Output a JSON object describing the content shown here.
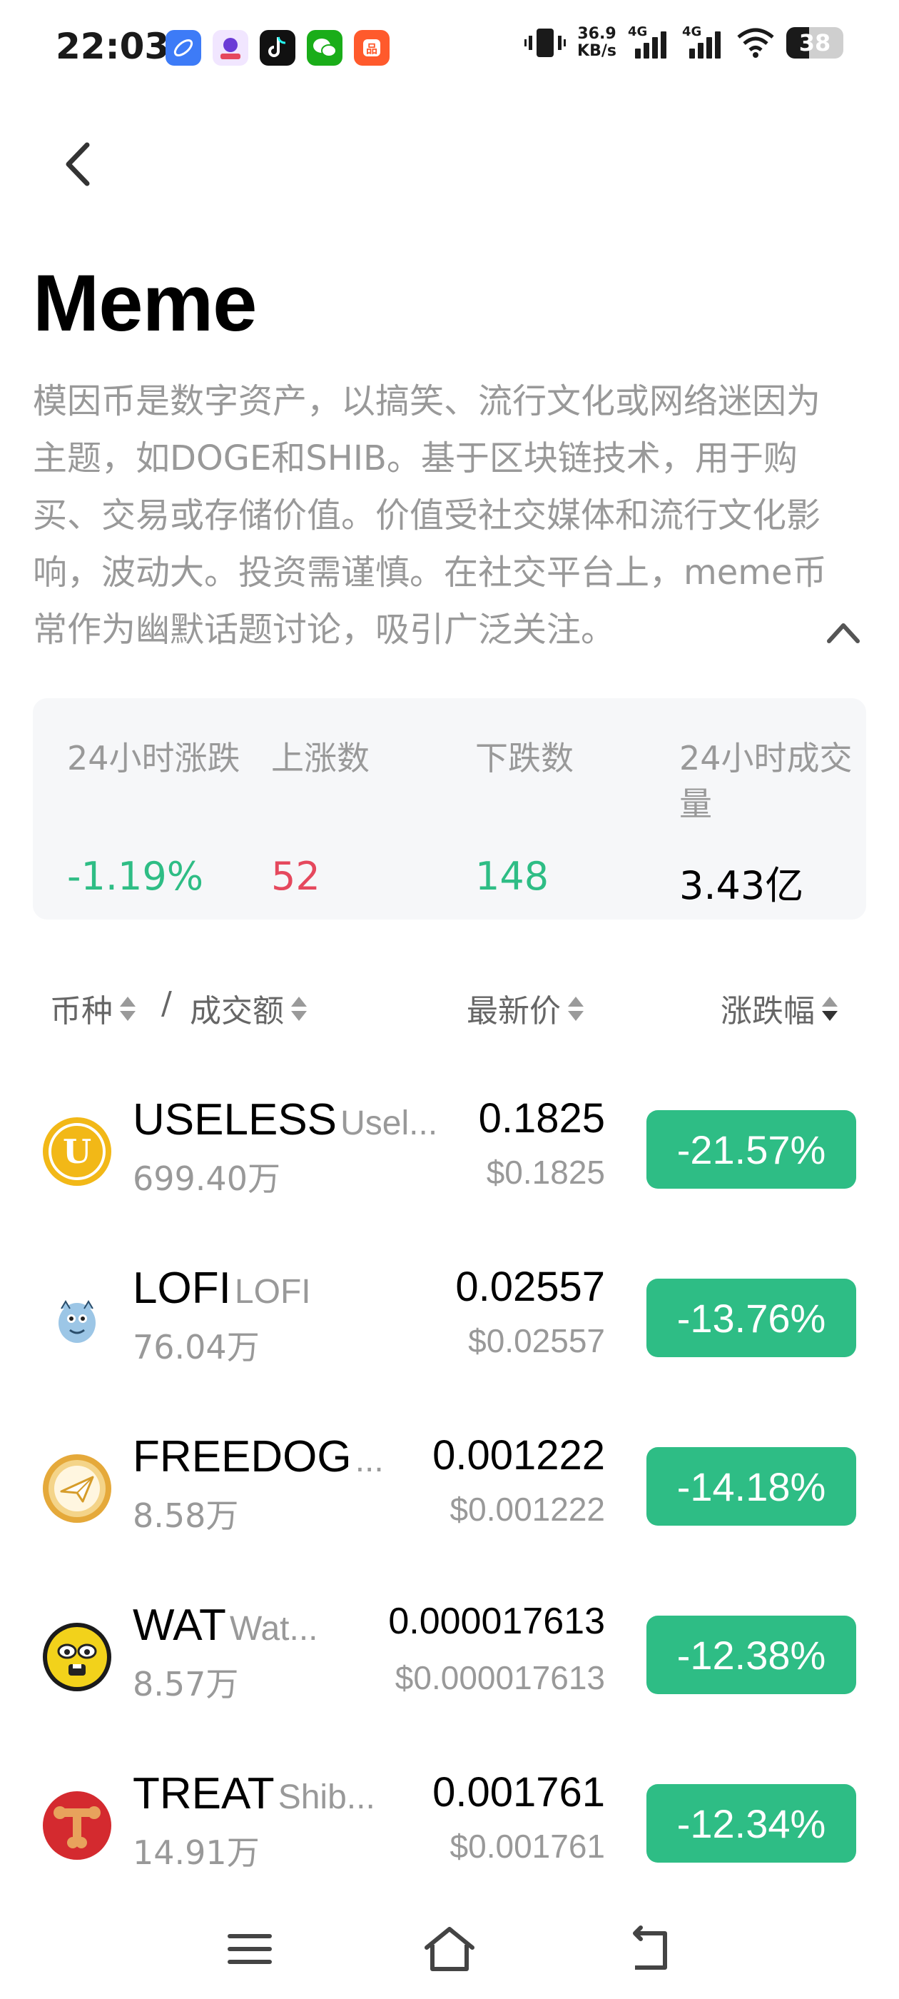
{
  "status_bar": {
    "time": "22:03",
    "speed_value": "36.9",
    "speed_unit": "KB/s",
    "sig1": "4G",
    "sig2": "4G",
    "battery": "38"
  },
  "header": {
    "title": "Meme",
    "description": "模因币是数字资产，以搞笑、流行文化或网络迷因为主题，如DOGE和SHIB。基于区块链技术，用于购买、交易或存储价值。价值受社交媒体和流行文化影响，波动大。投资需谨慎。在社交平台上，meme币常作为幽默话题讨论，吸引广泛关注。"
  },
  "stats": [
    {
      "label": "24小时涨跌",
      "value": "-1.19%",
      "color": "#2ebd85"
    },
    {
      "label": "上涨数",
      "value": "52",
      "color": "#e5485d"
    },
    {
      "label": "下跌数",
      "value": "148",
      "color": "#2ebd85"
    },
    {
      "label": "24小时成交量",
      "value": "3.43亿",
      "color": "#000000"
    }
  ],
  "list_header": {
    "coin": "币种",
    "separator": "/",
    "volume": "成交额",
    "price": "最新价",
    "change": "涨跌幅"
  },
  "coins": [
    {
      "symbol": "USELESS",
      "name": "Usel...",
      "volume": "699.40万",
      "price": "0.1825",
      "usd": "$0.1825",
      "change": "-21.57%",
      "icon": "useless-coin-icon"
    },
    {
      "symbol": "LOFI",
      "name": "LOFI",
      "volume": "76.04万",
      "price": "0.02557",
      "usd": "$0.02557",
      "change": "-13.76%",
      "icon": "lofi-coin-icon"
    },
    {
      "symbol": "FREEDOG",
      "name": "...",
      "volume": "8.58万",
      "price": "0.001222",
      "usd": "$0.001222",
      "change": "-14.18%",
      "icon": "freedog-coin-icon"
    },
    {
      "symbol": "WAT",
      "name": "Wat...",
      "volume": "8.57万",
      "price": "0.000017613",
      "usd": "$0.000017613",
      "change": "-12.38%",
      "icon": "wat-coin-icon"
    },
    {
      "symbol": "TREAT",
      "name": "Shib...",
      "volume": "14.91万",
      "price": "0.001761",
      "usd": "$0.001761",
      "change": "-12.34%",
      "icon": "treat-coin-icon"
    }
  ]
}
